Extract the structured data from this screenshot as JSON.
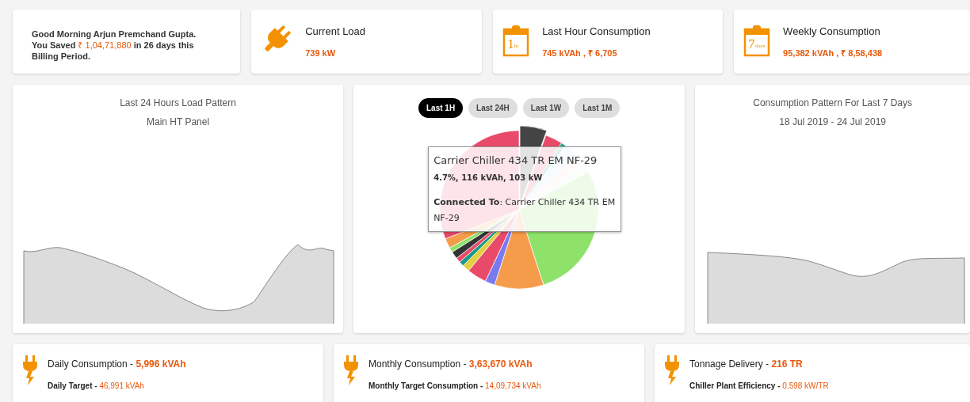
{
  "greeting": {
    "line1": "Good Morning Arjun Premchand Gupta.",
    "prefix": "You Saved",
    "amount": "₹ 1,04,71,880",
    "suffix": "in 26 days this Billing Period."
  },
  "stat_cards": [
    {
      "kind": "plug",
      "title": "Current Load",
      "value": "739 kW"
    },
    {
      "kind": "clipboard",
      "badge_number": "1",
      "badge_unit": "hr",
      "title": "Last Hour Consumption",
      "value": "745 kVAh , ₹ 6,705"
    },
    {
      "kind": "clipboard",
      "badge_number": "7",
      "badge_unit": "days",
      "title": "Weekly Consumption",
      "value": "95,382 kVAh , ₹ 8,58,438"
    }
  ],
  "load_chart": {
    "title": "Last 24 Hours Load Pattern",
    "subtitle": "Main HT Panel"
  },
  "pie_panel": {
    "tabs": [
      {
        "label": "Last 1H",
        "selected": true
      },
      {
        "label": "Last 24H",
        "selected": false
      },
      {
        "label": "Last 1W",
        "selected": false
      },
      {
        "label": "Last 1M",
        "selected": false
      }
    ],
    "tooltip": {
      "title": "Carrier Chiller 434 TR EM NF-29",
      "stats": "4.7%, 116 kVAh, 103 kW",
      "connected": "**Connected To**: Carrier Chiller 434 TR EM NF-29"
    }
  },
  "weekly_chart": {
    "title": "Consumption Pattern For Last 7 Days",
    "subtitle": "18 Jul 2019 - 24 Jul 2019"
  },
  "summary_cards": [
    {
      "title": "Daily Consumption -",
      "value": "5,996 kVAh",
      "sub_label": "Daily Target -",
      "sub_value": "46,991 kVAh"
    },
    {
      "title": "Monthly Consumption -",
      "value": "3,63,670 kVAh",
      "sub_label": "Monthly Target Consumption -",
      "sub_value": "14,09,734 kVAh"
    },
    {
      "title": "Tonnage Delivery -",
      "value": "216 TR",
      "sub_label": "Chiller Plant Efficiency -",
      "sub_value": "0.598 kW/TR"
    }
  ]
}
